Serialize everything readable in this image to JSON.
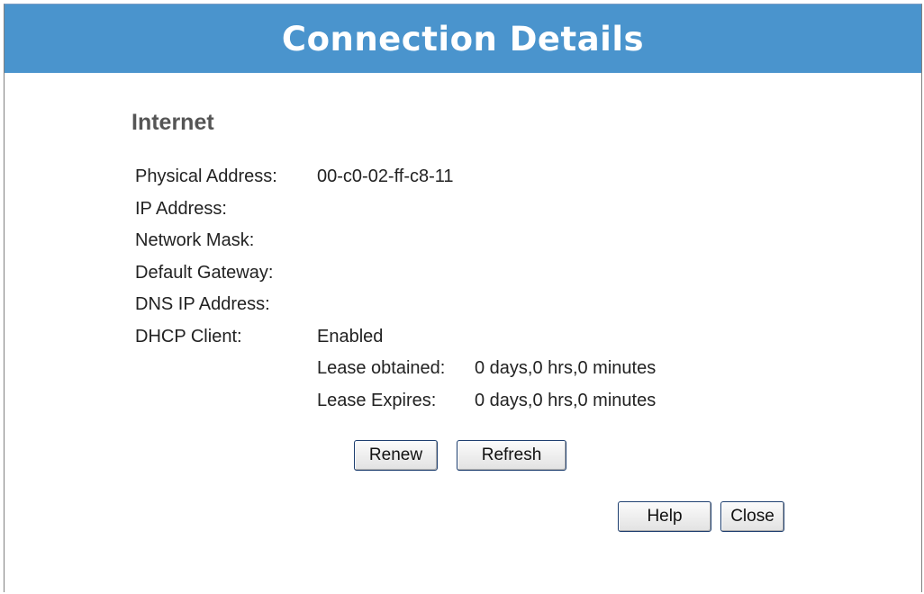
{
  "header": {
    "title": "Connection Details"
  },
  "section": {
    "title": "Internet"
  },
  "fields": {
    "physical_address_label": "Physical Address:",
    "physical_address_value": "00-c0-02-ff-c8-11",
    "ip_address_label": "IP Address:",
    "network_mask_label": "Network Mask:",
    "default_gateway_label": "Default Gateway:",
    "dns_ip_address_label": "DNS IP Address:",
    "dhcp_client_label": "DHCP Client:",
    "dhcp_client_value": "Enabled",
    "lease_obtained_label": "Lease obtained:",
    "lease_obtained_value": "0 days,0 hrs,0 minutes",
    "lease_expires_label": "Lease Expires:",
    "lease_expires_value": "0 days,0 hrs,0 minutes"
  },
  "buttons": {
    "renew": "Renew",
    "refresh": "Refresh",
    "help": "Help",
    "close": "Close"
  },
  "colors": {
    "header_background": "#4a94cd",
    "header_text": "#ffffff",
    "section_title": "#555555"
  }
}
